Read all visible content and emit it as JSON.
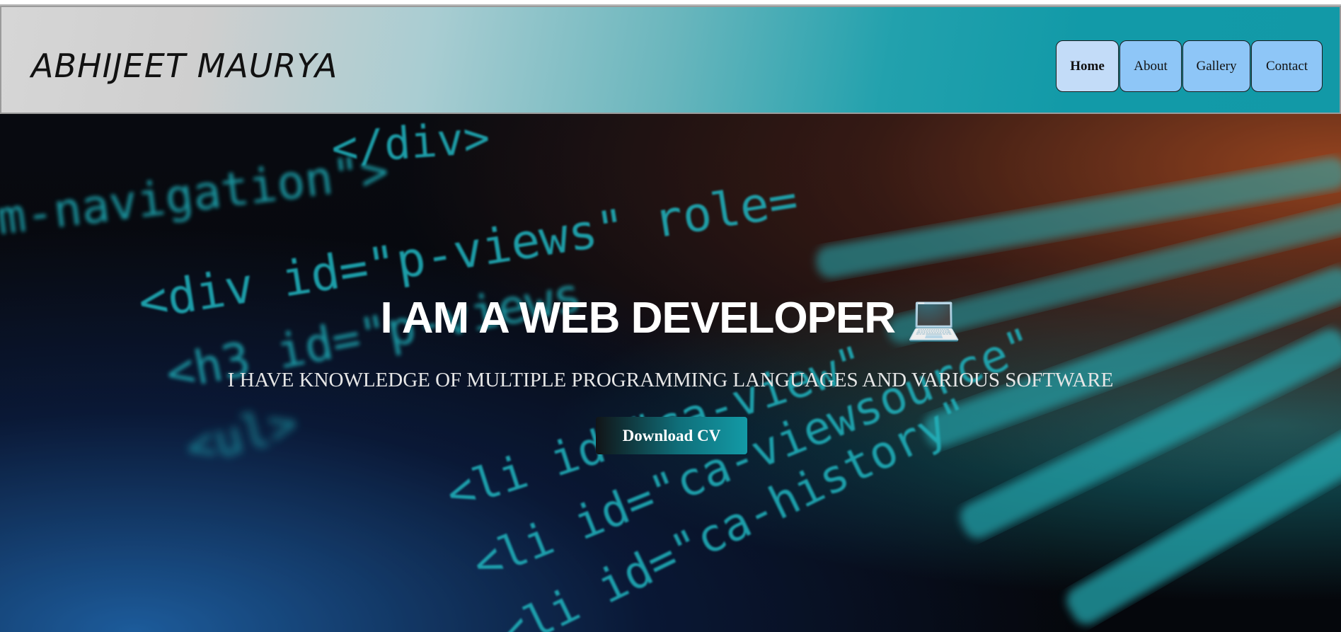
{
  "header": {
    "logo": "ABHIJEET MAURYA",
    "nav": [
      {
        "label": "Home",
        "active": true
      },
      {
        "label": "About",
        "active": false
      },
      {
        "label": "Gallery",
        "active": false
      },
      {
        "label": "Contact",
        "active": false
      }
    ]
  },
  "hero": {
    "title": "I AM A WEB DEVELOPER 💻",
    "subtitle": "I HAVE KNOWLEDGE OF MULTIPLE PROGRAMMING LANGUAGES AND VARIOUS SOFTWARE",
    "cta_label": "Download CV",
    "background_code_lines": [
      "</div>",
      "gm-navigation\">",
      "<div id=\"p-views\" role=",
      "<h3 id=\"p-views",
      "<ul>",
      "<li id=\"ca-view\"",
      "<li id=\"ca-viewsource\"",
      "<li id=\"ca-history\""
    ]
  },
  "colors": {
    "header_gradient_start": "#d6d6d6",
    "header_gradient_end": "#1299a7",
    "nav_button": "#8ec6f7",
    "nav_button_active": "#c3dcf8",
    "code_text": "#27d3e0",
    "cta_accent": "#139aa6"
  }
}
